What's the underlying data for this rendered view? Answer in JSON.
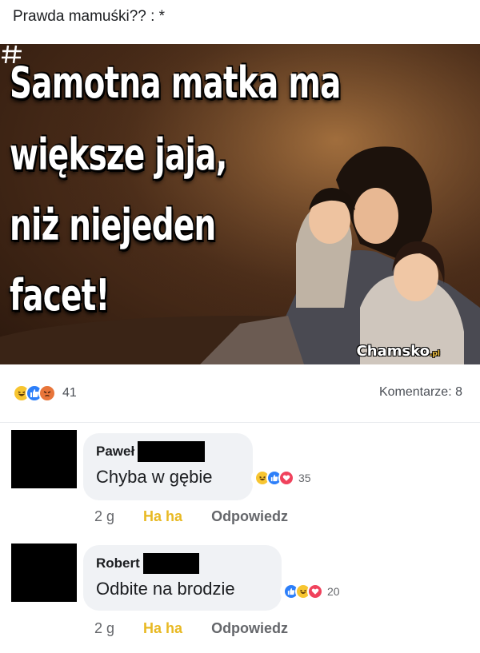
{
  "post": {
    "text": "Prawda mamuśki?? : *",
    "image": {
      "lines": [
        "Samotna matka ma",
        "większe jaja,",
        "niż niejeden",
        "facet!"
      ],
      "watermark": "Chamsko",
      "watermark_tld": ".pl"
    },
    "reactions": {
      "icons": [
        "haha-icon",
        "like-icon",
        "angry-icon"
      ],
      "count": "41"
    },
    "comments_label": "Komentarze: 8"
  },
  "comments": [
    {
      "author": "Paweł",
      "text": "Chyba w gębie",
      "reactions": {
        "icons": [
          "haha-icon",
          "like-icon",
          "love-icon"
        ],
        "count": "35"
      },
      "time": "2 g",
      "haha": "Ha ha",
      "reply": "Odpowiedz"
    },
    {
      "author": "Robert",
      "text": "Odbite na brodzie",
      "reactions": {
        "icons": [
          "like-icon",
          "haha-icon",
          "love-icon"
        ],
        "count": "20"
      },
      "time": "2 g",
      "haha": "Ha ha",
      "reply": "Odpowiedz"
    }
  ],
  "colors": {
    "haha": "#f7c531",
    "like": "#2d7ff9",
    "angry": "#e8753a",
    "love": "#f0425c",
    "haha_link": "#e8b923"
  }
}
